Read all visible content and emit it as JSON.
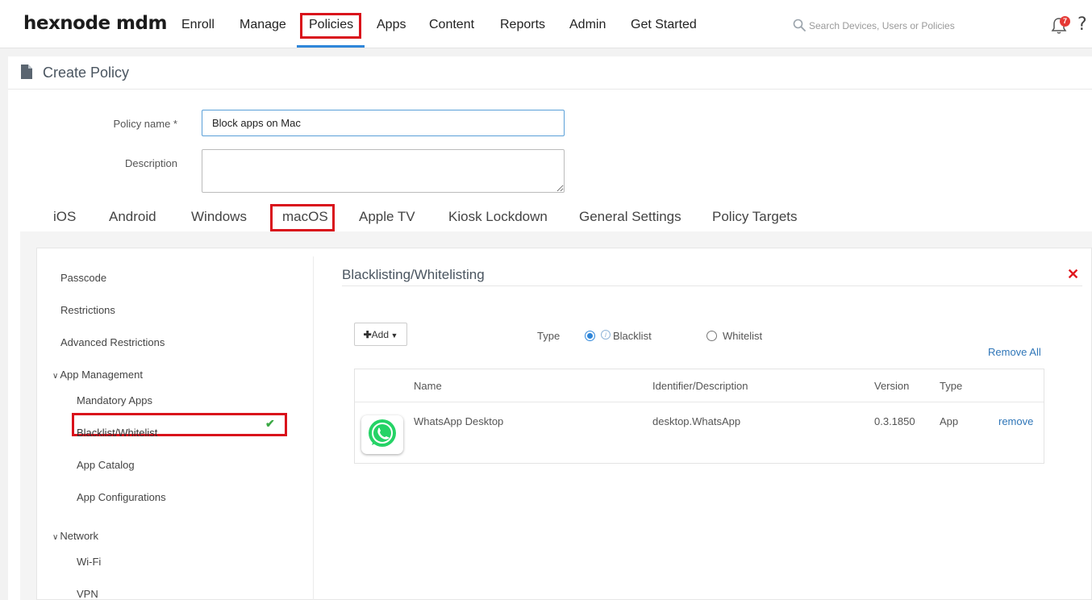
{
  "brand": {
    "logo": "hexnode mdm"
  },
  "nav": {
    "items": [
      "Enroll",
      "Manage",
      "Policies",
      "Apps",
      "Content",
      "Reports",
      "Admin",
      "Get Started"
    ]
  },
  "search": {
    "placeholder": "Search Devices, Users or Policies"
  },
  "notifications": {
    "count": "7"
  },
  "help": {
    "label": "?"
  },
  "page": {
    "title": "Create Policy"
  },
  "form": {
    "policy_name_label": "Policy name *",
    "policy_name_value": "Block apps on Mac",
    "description_label": "Description",
    "description_value": ""
  },
  "os_tabs": [
    "iOS",
    "Android",
    "Windows",
    "macOS",
    "Apple TV",
    "Kiosk Lockdown",
    "General Settings",
    "Policy Targets"
  ],
  "sidebar": {
    "items": [
      "Passcode",
      "Restrictions",
      "Advanced Restrictions"
    ],
    "app_management": {
      "label": "App Management",
      "items": [
        "Mandatory Apps",
        "Blacklist/Whitelist",
        "App Catalog",
        "App Configurations"
      ]
    },
    "network": {
      "label": "Network",
      "items": [
        "Wi-Fi",
        "VPN"
      ]
    }
  },
  "section": {
    "title": "Blacklisting/Whitelisting",
    "add_label": "Add",
    "type_label": "Type",
    "blacklist_label": "Blacklist",
    "whitelist_label": "Whitelist",
    "selected_type": "Blacklist",
    "remove_all_label": "Remove All"
  },
  "table": {
    "headers": [
      "Name",
      "Identifier/Description",
      "Version",
      "Type"
    ],
    "rows": [
      {
        "icon": "whatsapp-icon",
        "name": "WhatsApp Desktop",
        "identifier": "desktop.WhatsApp",
        "version": "0.3.1850",
        "type": "App",
        "action": "remove"
      }
    ]
  },
  "colors": {
    "accent": "#2f86d9",
    "highlight_box": "#d9111b",
    "link": "#2f76b8",
    "success": "#3aa844",
    "whatsapp": "#25d366"
  }
}
